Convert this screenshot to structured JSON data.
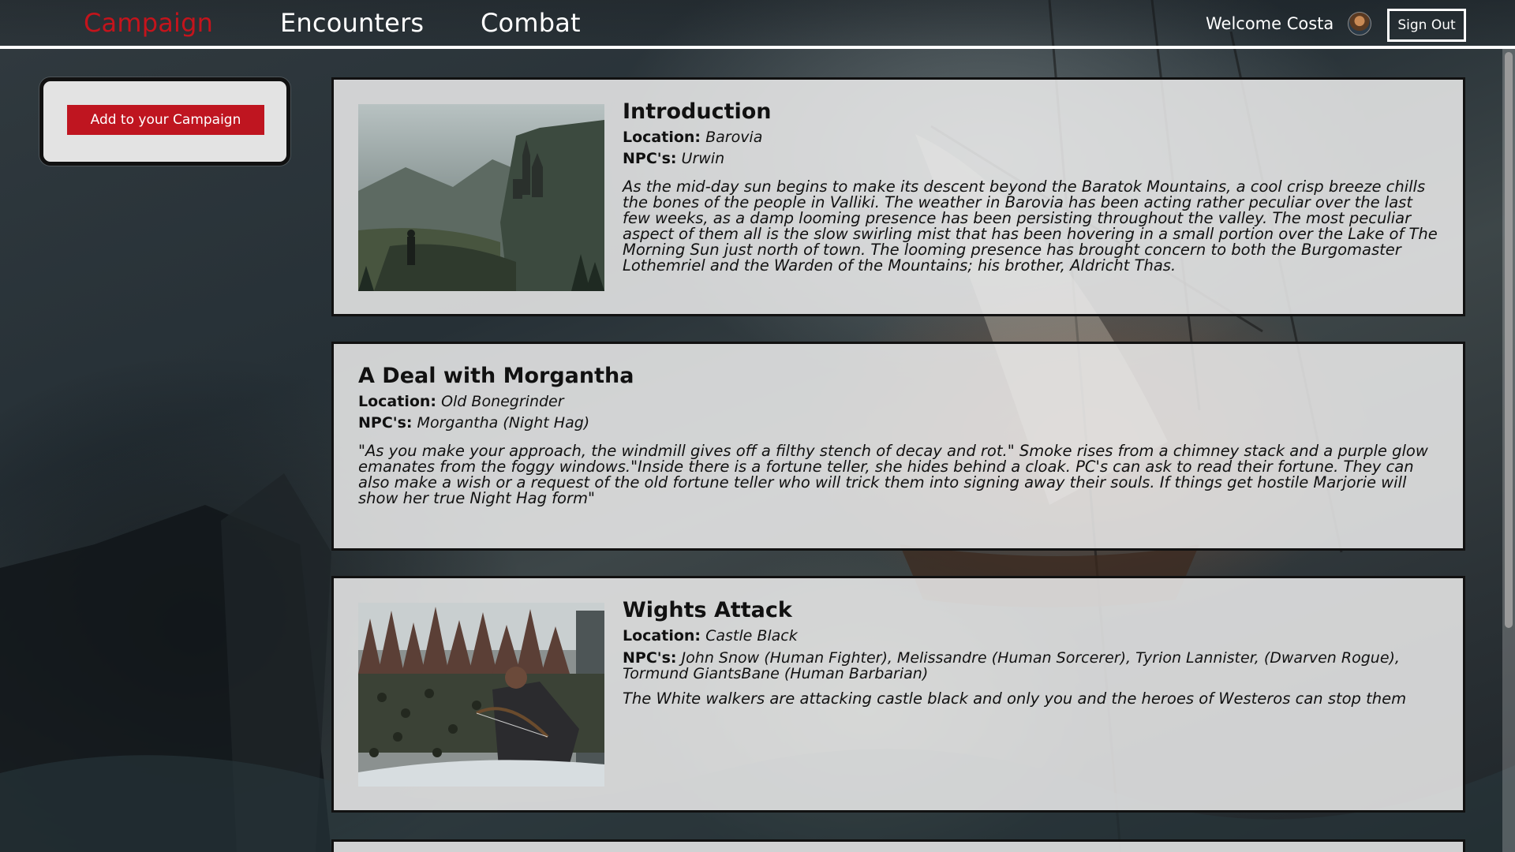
{
  "nav": {
    "links": [
      "Campaign",
      "Encounters",
      "Combat"
    ],
    "active": "Campaign",
    "welcome": "Welcome Costa",
    "sign_out": "Sign Out"
  },
  "sidebar": {
    "add_button": "Add to your Campaign"
  },
  "labels": {
    "location": "Location:",
    "npcs": "NPC's:"
  },
  "encounters": [
    {
      "title": "Introduction",
      "location": "Barovia",
      "npcs": "Urwin",
      "description": "As the mid-day sun begins to make its descent beyond the Baratok Mountains, a cool crisp breeze chills the bones of the people in Valliki. The weather in Barovia has been acting rather peculiar over the last few weeks, as a damp looming presence has been persisting throughout the valley. The most peculiar aspect of them all is the slow swirling mist that has been hovering in a small portion over the Lake of The Morning Sun just north of town. The looming presence has brought concern to both the Burgomaster Lothemriel and the Warden of the Mountains; his brother, Aldricht Thas.",
      "image": "castle-landscape"
    },
    {
      "title": "A Deal with Morgantha",
      "location": "Old Bonegrinder",
      "npcs": "Morgantha (Night Hag)",
      "description": "\"As you make your approach, the windmill gives off a filthy stench of decay and rot.\" Smoke rises from a chimney stack and a purple glow emanates from the foggy windows.\"Inside there is a fortune teller, she hides behind a cloak. PC's can ask to read their fortune. They can also make a wish or a request of the old fortune teller who will trick them into signing away their souls. If things get hostile Marjorie will show her true Night Hag form\"",
      "image": ""
    },
    {
      "title": "Wights Attack",
      "location": "Castle Black",
      "npcs": "John Snow (Human Fighter), Melissandre (Human Sorcerer), Tyrion Lannister, (Dwarven Rogue), Tormund GiantsBane (Human Barbarian)",
      "description": "The White walkers are attacking castle black and only you and the heroes of Westeros can stop them",
      "image": "archers-battle"
    }
  ]
}
